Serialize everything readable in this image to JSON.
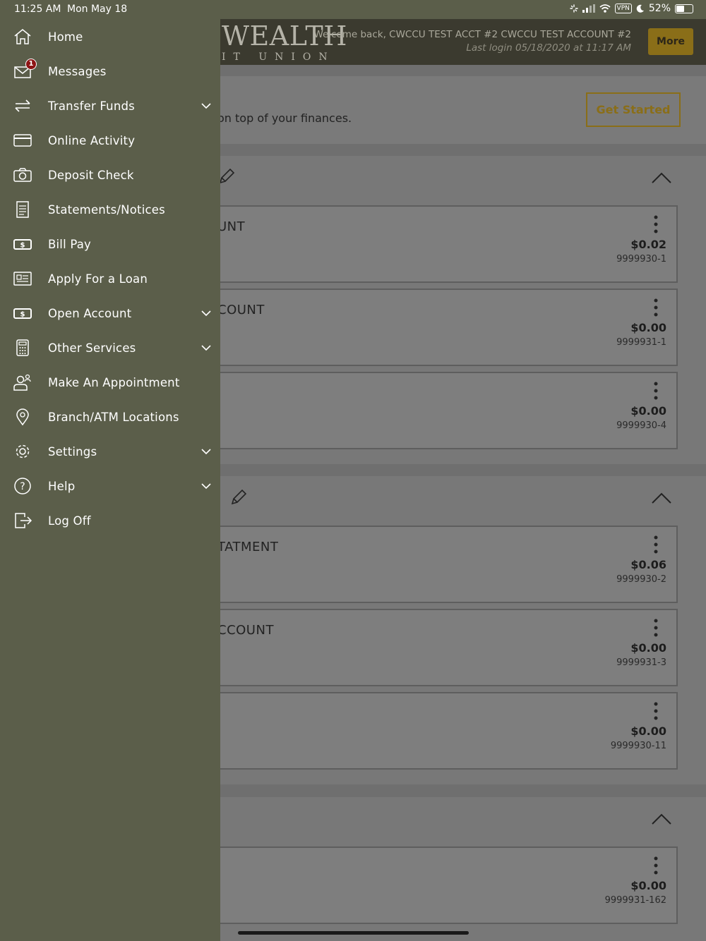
{
  "status_bar": {
    "time": "11:25 AM",
    "date": "Mon May 18",
    "vpn": "VPN",
    "battery": "52%",
    "battery_level": 0.52
  },
  "header": {
    "brand_top": "WEALTH",
    "brand_bottom": "IT UNION",
    "welcome": "Welcome back, CWCCU TEST ACCT #2 CWCCU TEST ACCOUNT #2",
    "last_login": "Last login 05/18/2020 at 11:17 AM",
    "more_label": "More"
  },
  "banner": {
    "text": "on top of your finances.",
    "get_started_label": "Get Started"
  },
  "accounts": [
    {
      "name": "UNT",
      "balance": "$0.02",
      "number": "9999930-1"
    },
    {
      "name": "COUNT",
      "balance": "$0.00",
      "number": "9999931-1"
    },
    {
      "name": "",
      "balance": "$0.00",
      "number": "9999930-4"
    },
    {
      "name": "TATMENT",
      "balance": "$0.06",
      "number": "9999930-2"
    },
    {
      "name": "CCOUNT",
      "balance": "$0.00",
      "number": "9999931-3"
    },
    {
      "name": "",
      "balance": "$0.00",
      "number": "9999930-11"
    },
    {
      "name": "",
      "balance": "$0.00",
      "number": "9999931-162"
    }
  ],
  "drawer": {
    "items": [
      {
        "label": "Home",
        "icon": "home-icon"
      },
      {
        "label": "Messages",
        "icon": "envelope-icon",
        "badge": "1"
      },
      {
        "label": "Transfer Funds",
        "icon": "transfer-arrows-icon",
        "expandable": true
      },
      {
        "label": "Online Activity",
        "icon": "credit-card-icon"
      },
      {
        "label": "Deposit Check",
        "icon": "camera-icon"
      },
      {
        "label": "Statements/Notices",
        "icon": "document-icon"
      },
      {
        "label": "Bill Pay",
        "icon": "dollar-bill-icon"
      },
      {
        "label": "Apply For a Loan",
        "icon": "newspaper-icon"
      },
      {
        "label": "Open Account",
        "icon": "dollar-bill-icon",
        "expandable": true
      },
      {
        "label": "Other Services",
        "icon": "calculator-icon",
        "expandable": true
      },
      {
        "label": "Make An Appointment",
        "icon": "people-icon"
      },
      {
        "label": "Branch/ATM Locations",
        "icon": "map-pin-icon"
      },
      {
        "label": "Settings",
        "icon": "gear-icon",
        "expandable": true
      },
      {
        "label": "Help",
        "icon": "question-circle-icon",
        "expandable": true
      },
      {
        "label": "Log Off",
        "icon": "logout-icon"
      }
    ]
  },
  "colors": {
    "drawer_bg": "#5b5e4a",
    "accent_gold": "#8a6e18",
    "badge_red": "#8d1414"
  }
}
